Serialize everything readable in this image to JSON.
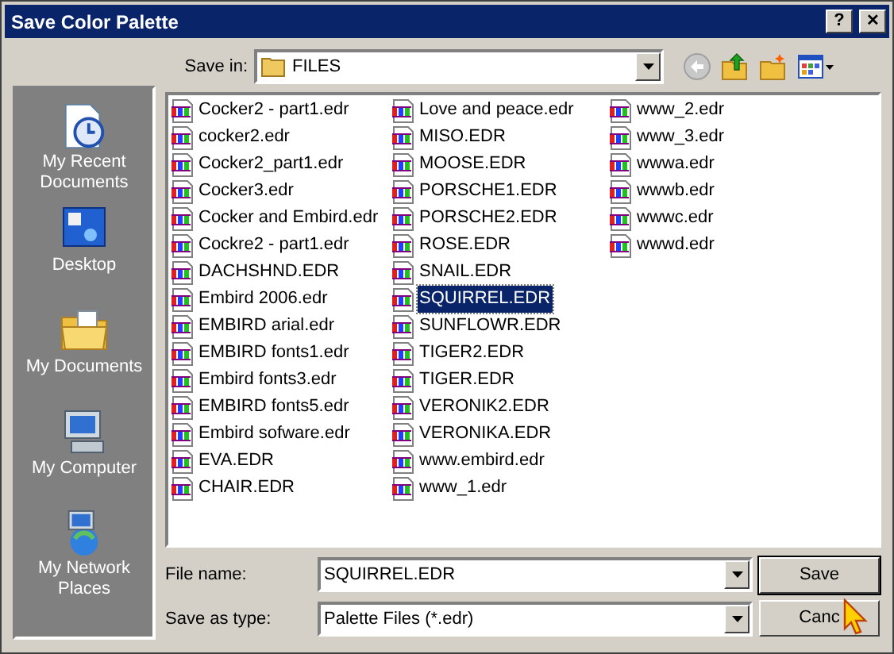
{
  "window": {
    "title": "Save Color Palette",
    "buttons": [
      {
        "kind": "help",
        "label": "?"
      },
      {
        "kind": "close",
        "label": "✕"
      }
    ]
  },
  "save_in": {
    "label": "Save in:",
    "value": "FILES"
  },
  "toolbar": [
    {
      "kind": "back",
      "disabled": true
    },
    {
      "kind": "up",
      "disabled": false
    },
    {
      "kind": "new-folder",
      "disabled": false
    },
    {
      "kind": "views",
      "disabled": false
    }
  ],
  "places": [
    {
      "kind": "recent",
      "label": "My Recent Documents",
      "selected": false
    },
    {
      "kind": "desktop",
      "label": "Desktop",
      "selected": false
    },
    {
      "kind": "documents",
      "label": "My Documents",
      "selected": false
    },
    {
      "kind": "computer",
      "label": "My Computer",
      "selected": false
    },
    {
      "kind": "network",
      "label": "My Network Places",
      "selected": false
    }
  ],
  "columns": [
    {
      "files": [
        {
          "name": "Cocker2 - part1.edr",
          "selected": false
        },
        {
          "name": "cocker2.edr",
          "selected": false
        },
        {
          "name": "Cocker2_part1.edr",
          "selected": false
        },
        {
          "name": "Cocker3.edr",
          "selected": false
        },
        {
          "name": "Cocker and Embird.edr",
          "selected": false
        },
        {
          "name": "Cockre2 - part1.edr",
          "selected": false
        },
        {
          "name": "DACHSHND.EDR",
          "selected": false
        },
        {
          "name": "Embird 2006.edr",
          "selected": false
        },
        {
          "name": "EMBIRD arial.edr",
          "selected": false
        },
        {
          "name": "EMBIRD fonts1.edr",
          "selected": false
        },
        {
          "name": "Embird fonts3.edr",
          "selected": false
        },
        {
          "name": "EMBIRD fonts5.edr",
          "selected": false
        },
        {
          "name": "Embird sofware.edr",
          "selected": false
        },
        {
          "name": "EVA.EDR",
          "selected": false
        },
        {
          "name": "CHAIR.EDR",
          "selected": false
        }
      ]
    },
    {
      "files": [
        {
          "name": "Love and peace.edr",
          "selected": false
        },
        {
          "name": "MISO.EDR",
          "selected": false
        },
        {
          "name": "MOOSE.EDR",
          "selected": false
        },
        {
          "name": "PORSCHE1.EDR",
          "selected": false
        },
        {
          "name": "PORSCHE2.EDR",
          "selected": false
        },
        {
          "name": "ROSE.EDR",
          "selected": false
        },
        {
          "name": "SNAIL.EDR",
          "selected": false
        },
        {
          "name": "SQUIRREL.EDR",
          "selected": true
        },
        {
          "name": "SUNFLOWR.EDR",
          "selected": false
        },
        {
          "name": "TIGER2.EDR",
          "selected": false
        },
        {
          "name": "TIGER.EDR",
          "selected": false
        },
        {
          "name": "VERONIK2.EDR",
          "selected": false
        },
        {
          "name": "VERONIKA.EDR",
          "selected": false
        },
        {
          "name": "www.embird.edr",
          "selected": false
        },
        {
          "name": "www_1.edr",
          "selected": false
        }
      ]
    },
    {
      "files": [
        {
          "name": "www_2.edr",
          "selected": false
        },
        {
          "name": "www_3.edr",
          "selected": false
        },
        {
          "name": "wwwa.edr",
          "selected": false
        },
        {
          "name": "wwwb.edr",
          "selected": false
        },
        {
          "name": "wwwc.edr",
          "selected": false
        },
        {
          "name": "wwwd.edr",
          "selected": false
        }
      ]
    }
  ],
  "file_name": {
    "label": "File name:",
    "value": "SQUIRREL.EDR"
  },
  "save_as_type": {
    "label": "Save as type:",
    "value": "Palette Files (*.edr)"
  },
  "buttons": [
    {
      "label": "Save",
      "default": true
    },
    {
      "label": "Canc",
      "default": false
    }
  ]
}
